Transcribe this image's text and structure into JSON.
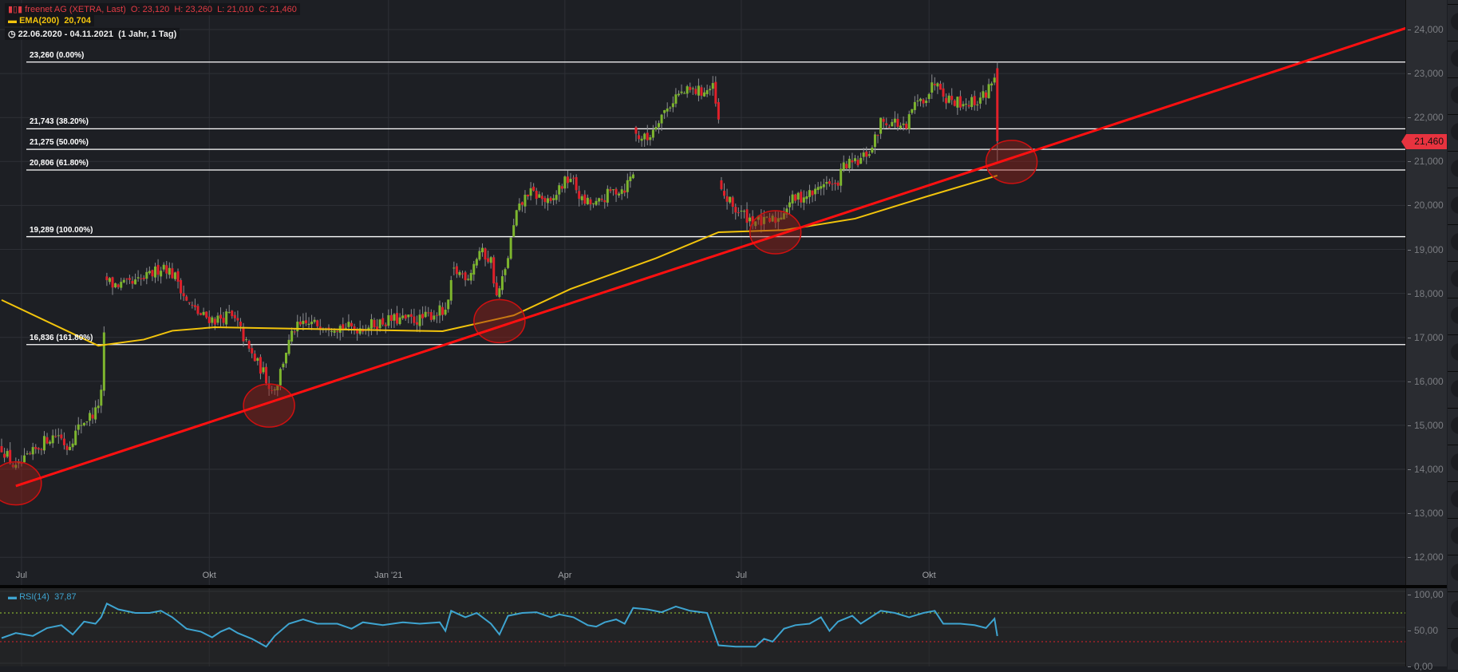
{
  "header": {
    "instrument": "freenet AG (XETRA, Last)",
    "ohlc": "O: 23,120  H: 23,260  L: 21,010  C: 21,460",
    "ema_label": "EMA(200)",
    "ema_value": "20,704",
    "range": "22.06.2020 - 04.11.2021",
    "range_detail": "(1 Jahr, 1 Tag)"
  },
  "last_price_tag": "21,460",
  "rsi_legend": {
    "label": "RSI(14)",
    "value": "37,87"
  },
  "colors": {
    "up": "#7db52e",
    "down": "#e0202a",
    "ema": "#f2c40c",
    "trend": "#ff1010",
    "rsi": "#3ea4d0",
    "bg": "#1d1f24"
  },
  "chart_data": {
    "type": "candlestick",
    "title": "freenet AG (XETRA, Last)",
    "x_unit": "trading day index",
    "ylim": [
      11.3,
      24.6
    ],
    "y_ticks": [
      {
        "v": 24,
        "label": "24,000"
      },
      {
        "v": 23,
        "label": "23,000"
      },
      {
        "v": 22,
        "label": "22,000"
      },
      {
        "v": 21,
        "label": "21,000"
      },
      {
        "v": 20,
        "label": "20,000"
      },
      {
        "v": 19,
        "label": "19,000"
      },
      {
        "v": 18,
        "label": "18,000"
      },
      {
        "v": 17,
        "label": "17,000"
      },
      {
        "v": 16,
        "label": "16,000"
      },
      {
        "v": 15,
        "label": "15,000"
      },
      {
        "v": 14,
        "label": "14,000"
      },
      {
        "v": 13,
        "label": "13,000"
      },
      {
        "v": 12,
        "label": "12,000"
      }
    ],
    "x_ticks": [
      {
        "d": 7,
        "label": "Jul"
      },
      {
        "d": 73,
        "label": "Okt"
      },
      {
        "d": 136,
        "label": "Jan '21"
      },
      {
        "d": 198,
        "label": "Apr"
      },
      {
        "d": 260,
        "label": "Jul"
      },
      {
        "d": 326,
        "label": "Okt"
      }
    ],
    "close_keypoints": [
      [
        0,
        14.5
      ],
      [
        5,
        14.0
      ],
      [
        10,
        14.3
      ],
      [
        16,
        14.7
      ],
      [
        20,
        14.8
      ],
      [
        23,
        14.5
      ],
      [
        28,
        15.05
      ],
      [
        33,
        15.3
      ],
      [
        35,
        15.7
      ],
      [
        37,
        18.3
      ],
      [
        39,
        18.2
      ],
      [
        46,
        18.2
      ],
      [
        52,
        18.4
      ],
      [
        57,
        18.65
      ],
      [
        62,
        18.3
      ],
      [
        65,
        17.8
      ],
      [
        70,
        17.5
      ],
      [
        75,
        17.4
      ],
      [
        80,
        17.5
      ],
      [
        83,
        17.3
      ],
      [
        87,
        16.7
      ],
      [
        92,
        16.2
      ],
      [
        95,
        15.8
      ],
      [
        97,
        16.0
      ],
      [
        100,
        16.7
      ],
      [
        103,
        17.2
      ],
      [
        108,
        17.3
      ],
      [
        114,
        17.3
      ],
      [
        124,
        17.2
      ],
      [
        131,
        17.3
      ],
      [
        137,
        17.4
      ],
      [
        147,
        17.4
      ],
      [
        154,
        17.6
      ],
      [
        156,
        17.5
      ],
      [
        159,
        18.5
      ],
      [
        164,
        18.4
      ],
      [
        168,
        18.96
      ],
      [
        172,
        18.75
      ],
      [
        174,
        17.9
      ],
      [
        177,
        18.5
      ],
      [
        179,
        19.2
      ],
      [
        181,
        19.8
      ],
      [
        185,
        20.3
      ],
      [
        189,
        20.2
      ],
      [
        193,
        20.0
      ],
      [
        196,
        20.4
      ],
      [
        200,
        20.65
      ],
      [
        204,
        20.1
      ],
      [
        209,
        20.0
      ],
      [
        214,
        20.3
      ],
      [
        219,
        20.4
      ],
      [
        222,
        20.75
      ],
      [
        223,
        21.6
      ],
      [
        227,
        21.5
      ],
      [
        231,
        22.0
      ],
      [
        234,
        22.2
      ],
      [
        237,
        22.5
      ],
      [
        242,
        22.6
      ],
      [
        247,
        22.6
      ],
      [
        250,
        22.66
      ],
      [
        252,
        21.9
      ],
      [
        253,
        20.3
      ],
      [
        258,
        19.9
      ],
      [
        263,
        19.7
      ],
      [
        268,
        19.6
      ],
      [
        273,
        19.7
      ],
      [
        277,
        20.1
      ],
      [
        281,
        20.2
      ],
      [
        286,
        20.3
      ],
      [
        289,
        20.55
      ],
      [
        293,
        20.4
      ],
      [
        296,
        20.9
      ],
      [
        301,
        20.97
      ],
      [
        306,
        21.3
      ],
      [
        309,
        21.9
      ],
      [
        314,
        21.9
      ],
      [
        318,
        21.7
      ],
      [
        320,
        22.2
      ],
      [
        325,
        22.5
      ],
      [
        329,
        22.9
      ],
      [
        332,
        22.45
      ],
      [
        337,
        22.35
      ],
      [
        342,
        22.35
      ],
      [
        346,
        22.55
      ],
      [
        349,
        22.98
      ]
    ],
    "gap_days": [
      37,
      159,
      223,
      253
    ],
    "last_candle": {
      "d": 350,
      "o": 23.12,
      "h": 23.26,
      "l": 21.01,
      "c": 21.46
    },
    "ema200": [
      [
        0,
        17.85
      ],
      [
        34,
        16.81
      ],
      [
        50,
        16.95
      ],
      [
        60,
        17.15
      ],
      [
        75,
        17.23
      ],
      [
        100,
        17.2
      ],
      [
        155,
        17.14
      ],
      [
        180,
        17.5
      ],
      [
        200,
        18.1
      ],
      [
        230,
        18.8
      ],
      [
        252,
        19.39
      ],
      [
        275,
        19.44
      ],
      [
        300,
        19.7
      ],
      [
        325,
        20.2
      ],
      [
        350,
        20.68
      ]
    ],
    "trendline": [
      [
        5,
        13.62
      ],
      [
        494,
        24.04
      ]
    ],
    "highlight_circles": [
      [
        5,
        13.68
      ],
      [
        94,
        15.45
      ],
      [
        175,
        17.37
      ],
      [
        272,
        19.39
      ],
      [
        355,
        20.99
      ]
    ],
    "fibonacci": [
      {
        "v": 23.26,
        "label": "23,260 (0.00%)"
      },
      {
        "v": 21.743,
        "label": "21,743 (38.20%)"
      },
      {
        "v": 21.275,
        "label": "21,275 (50.00%)"
      },
      {
        "v": 20.806,
        "label": "20,806 (61.80%)"
      },
      {
        "v": 19.289,
        "label": "19,289 (100.00%)"
      },
      {
        "v": 16.836,
        "label": "16,836 (161.80%)"
      }
    ],
    "rsi": {
      "ticks": [
        {
          "v": 100,
          "label": "100,00"
        },
        {
          "v": 50,
          "label": "50,00"
        },
        {
          "v": 0,
          "label": "0,00"
        }
      ],
      "overbought": 70,
      "oversold": 30,
      "values": [
        [
          0,
          35
        ],
        [
          5,
          42
        ],
        [
          11,
          38
        ],
        [
          16,
          49
        ],
        [
          21,
          53
        ],
        [
          25,
          40
        ],
        [
          29,
          58
        ],
        [
          33,
          55
        ],
        [
          35,
          64
        ],
        [
          37,
          83
        ],
        [
          41,
          75
        ],
        [
          47,
          70
        ],
        [
          52,
          70
        ],
        [
          56,
          73
        ],
        [
          60,
          64
        ],
        [
          65,
          48
        ],
        [
          70,
          44
        ],
        [
          74,
          36
        ],
        [
          77,
          44
        ],
        [
          80,
          49
        ],
        [
          83,
          42
        ],
        [
          88,
          34
        ],
        [
          93,
          23
        ],
        [
          96,
          38
        ],
        [
          101,
          55
        ],
        [
          106,
          61
        ],
        [
          111,
          55
        ],
        [
          118,
          55
        ],
        [
          123,
          48
        ],
        [
          127,
          57
        ],
        [
          134,
          53
        ],
        [
          141,
          57
        ],
        [
          147,
          55
        ],
        [
          154,
          57
        ],
        [
          156,
          45
        ],
        [
          158,
          73
        ],
        [
          163,
          64
        ],
        [
          167,
          70
        ],
        [
          172,
          55
        ],
        [
          175,
          40
        ],
        [
          178,
          66
        ],
        [
          183,
          70
        ],
        [
          188,
          71
        ],
        [
          193,
          64
        ],
        [
          196,
          68
        ],
        [
          201,
          64
        ],
        [
          206,
          53
        ],
        [
          209,
          51
        ],
        [
          212,
          57
        ],
        [
          216,
          61
        ],
        [
          219,
          55
        ],
        [
          222,
          77
        ],
        [
          227,
          75
        ],
        [
          232,
          71
        ],
        [
          237,
          79
        ],
        [
          242,
          73
        ],
        [
          248,
          70
        ],
        [
          252,
          25
        ],
        [
          258,
          23
        ],
        [
          265,
          23
        ],
        [
          268,
          34
        ],
        [
          271,
          30
        ],
        [
          275,
          48
        ],
        [
          279,
          53
        ],
        [
          284,
          55
        ],
        [
          288,
          64
        ],
        [
          291,
          45
        ],
        [
          294,
          58
        ],
        [
          299,
          66
        ],
        [
          302,
          55
        ],
        [
          309,
          73
        ],
        [
          314,
          70
        ],
        [
          319,
          64
        ],
        [
          324,
          70
        ],
        [
          328,
          73
        ],
        [
          331,
          55
        ],
        [
          337,
          55
        ],
        [
          342,
          53
        ],
        [
          346,
          49
        ],
        [
          349,
          62
        ],
        [
          350,
          37.87
        ]
      ]
    }
  }
}
